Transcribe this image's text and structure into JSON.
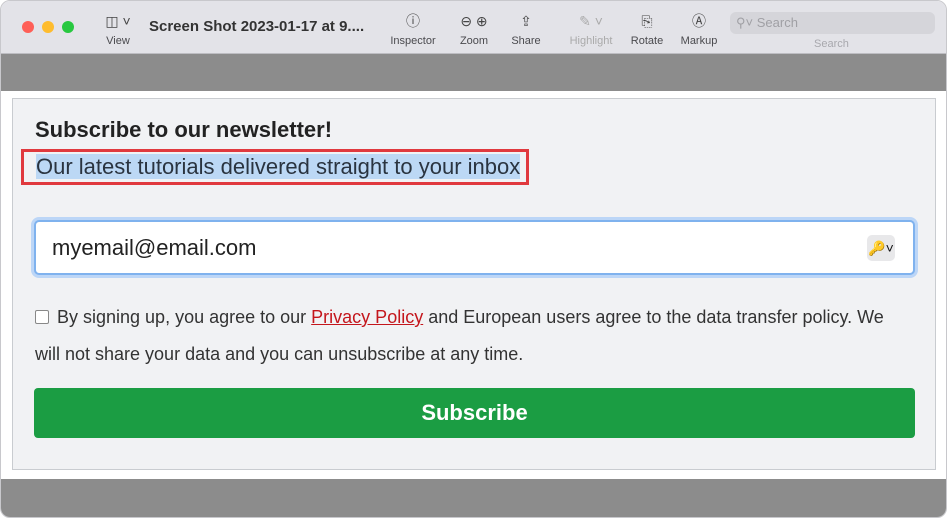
{
  "window": {
    "title": "Screen Shot 2023-01-17 at 9....",
    "colors": {
      "close": "#fe5f57",
      "minimize": "#febc2e",
      "zoom": "#28c840"
    }
  },
  "toolbar": {
    "view": "View",
    "inspector": "Inspector",
    "zoom": "Zoom",
    "share": "Share",
    "highlight": "Highlight",
    "rotate": "Rotate",
    "markup": "Markup",
    "search_placeholder": "Search",
    "search_label": "Search"
  },
  "form": {
    "heading": "Subscribe to our newsletter!",
    "subheading": "Our latest tutorials delivered straight to your inbox",
    "email_value": "myemail@email.com",
    "agree_pre": "By signing up, you agree to our ",
    "privacy_link": "Privacy Policy",
    "agree_post": " and European users agree to the data transfer policy. We will not share your data and you can unsubscribe at any time.",
    "subscribe": "Subscribe",
    "button_color": "#1b9d43"
  }
}
